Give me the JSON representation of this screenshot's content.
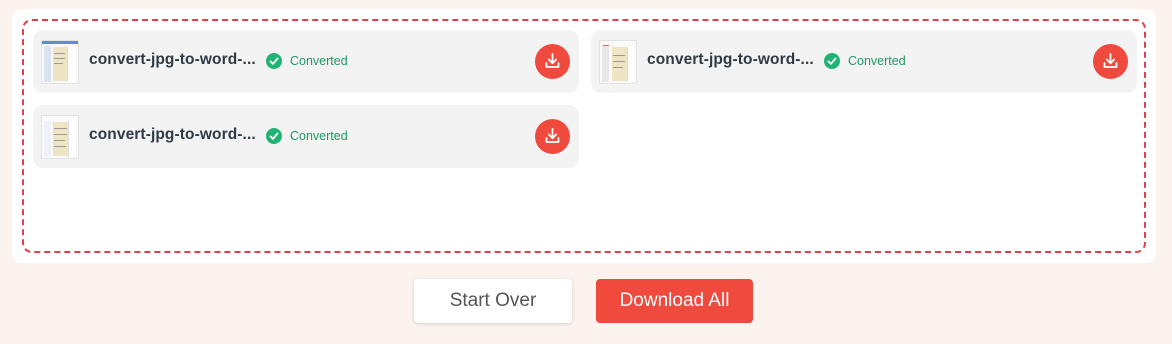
{
  "files": [
    {
      "name": "convert-jpg-to-word-...",
      "status": "Converted"
    },
    {
      "name": "convert-jpg-to-word-...",
      "status": "Converted"
    },
    {
      "name": "convert-jpg-to-word-...",
      "status": "Converted"
    }
  ],
  "icons": {
    "status": "check-circle-icon",
    "download": "download-icon",
    "thumbnail": "document-thumbnail"
  },
  "actions": {
    "start_over": "Start Over",
    "download_all": "Download All"
  },
  "colors": {
    "accent": "#f04a3e",
    "success": "#20b373",
    "dropzone_border": "#e0404a",
    "background": "#fcf3ee"
  }
}
